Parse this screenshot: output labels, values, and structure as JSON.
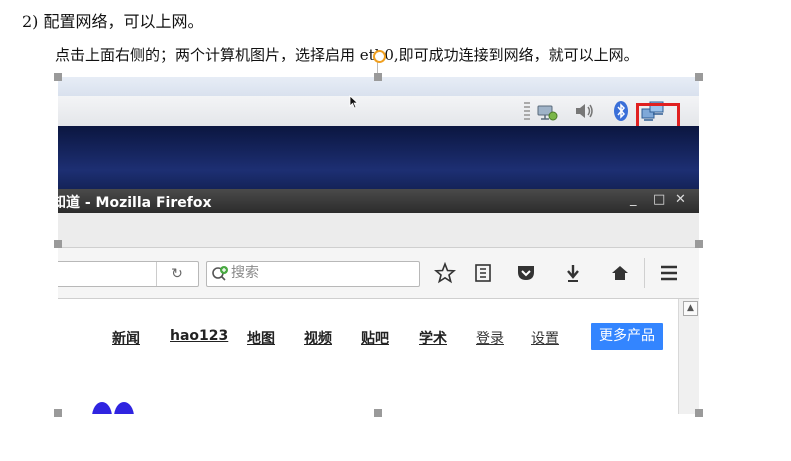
{
  "document": {
    "heading": "2) 配置网络，可以上网。",
    "instruction": "点击上面右侧的；两个计算机图片，选择启用 eth0,即可成功连接到网络，就可以上网。"
  },
  "tray": {
    "icons": [
      "wired-network-icon",
      "volume-icon",
      "bluetooth-icon",
      "network-manager-icon"
    ],
    "highlight_color": "#e02020"
  },
  "firefox": {
    "title": "知道 - Mozilla Firefox",
    "window_buttons": {
      "minimize": "_",
      "maximize": "□",
      "close": "✕"
    },
    "reload_symbol": "↻",
    "search_placeholder": "搜索"
  },
  "page": {
    "nav": [
      "新闻",
      "hao123",
      "地图",
      "视频",
      "贴吧",
      "学术",
      "登录",
      "设置"
    ],
    "more_button": "更多产品",
    "more_button_color": "#3385ff"
  },
  "colors": {
    "desktop": "#1d2f73",
    "titlebar": "#2c2c2c",
    "logo": "#2f24e0"
  }
}
